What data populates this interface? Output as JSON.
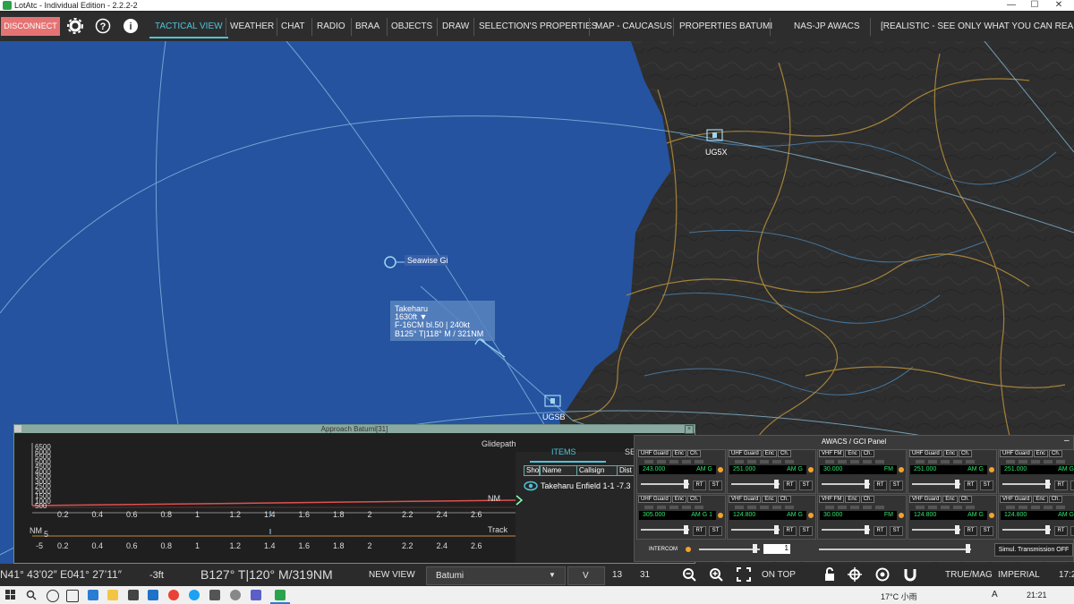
{
  "window": {
    "title": "LotAtc - Individual Edition - 2.2.2-2",
    "minimize": "—",
    "maximize": "☐",
    "close": "✕"
  },
  "menu": {
    "disconnect": "DISCONNECT",
    "items": [
      "TACTICAL VIEW",
      "WEATHER",
      "CHAT",
      "RADIO",
      "BRAA",
      "OBJECTS",
      "DRAW",
      "SELECTION'S PROPERTIES",
      "MAP - CAUCASUS",
      "PROPERTIES BATUMI",
      "NAS-JP AWACS",
      "[REALISTIC - SEE ONLY WHAT YOU CAN REALLY S"
    ]
  },
  "map": {
    "airbases": [
      {
        "name": "UG5X"
      },
      {
        "name": "UGSB"
      }
    ],
    "ship_label": "Seawise Gi",
    "track": {
      "line1": "Takeharu",
      "line2": "1630ft  ▼",
      "line3": "F-16CM bl.50 | 240kt",
      "line4": "B125°  T|118°  M / 321NM"
    }
  },
  "approach": {
    "title": "Approach Batumi[31]",
    "glidepath_label": "Glidepath",
    "track_label": "Track",
    "nm_label": "NM",
    "nm_label2": "NM",
    "y_ticks": [
      "6500",
      "6000",
      "5500",
      "5000",
      "4500",
      "4000",
      "3500",
      "3000",
      "2500",
      "2000",
      "1500",
      "1000",
      "500"
    ],
    "x_ticks": [
      "0.2",
      "0.4",
      "0.6",
      "0.8",
      "1",
      "1.2",
      "1.4",
      "1.6",
      "1.8",
      "2",
      "2.2",
      "2.4",
      "2.6"
    ],
    "track_y_ticks": [
      "5",
      "-5"
    ]
  },
  "items_panel": {
    "tab_items": "ITEMS",
    "tab_set": "SE",
    "columns": [
      "Sho",
      "Name",
      "Callsign",
      "Dist"
    ],
    "rows": [
      {
        "text": "Takeharu Enfield 1-1  -7.3"
      }
    ]
  },
  "awacs": {
    "title": "AWACS / GCI Panel",
    "radios": [
      {
        "type": "UHF Guard",
        "freq": "243.000",
        "mod": "AM G"
      },
      {
        "type": "UHF Guard",
        "freq": "251.000",
        "mod": "AM G"
      },
      {
        "type": "VHF FM",
        "freq": "30.000",
        "mod": "FM"
      },
      {
        "type": "UHF Guard",
        "freq": "251.000",
        "mod": "AM G"
      },
      {
        "type": "UHF Guard",
        "freq": "251.000",
        "mod": "AM G"
      },
      {
        "type": "UHF Guard",
        "freq": "305.000",
        "mod": "AM G  1"
      },
      {
        "type": "VHF Guard",
        "freq": "124.800",
        "mod": "AM G"
      },
      {
        "type": "VHF FM",
        "freq": "30.000",
        "mod": "FM"
      },
      {
        "type": "VHF Guard",
        "freq": "124.800",
        "mod": "AM G"
      },
      {
        "type": "VHF Guard",
        "freq": "124.800",
        "mod": "AM G"
      }
    ],
    "enc": "Enc",
    "ch": "Ch.",
    "rt": "RT",
    "st": "ST",
    "intercom": "INTERCOM",
    "intercom_value": "1",
    "simul": "Simul. Transmission OFF"
  },
  "status": {
    "coords": "N41° 43’02″ E041° 27’11″",
    "alt": "-3ft",
    "bearing": "B127°  T|120°  M/319NM",
    "new_view": "NEW VIEW",
    "airport": "Batumi",
    "v": "V",
    "n13": "13",
    "n31": "31",
    "on_top": "ON TOP",
    "true_mag": "TRUE/MAG",
    "imperial": "IMPERIAL",
    "time_cut": "17:2"
  },
  "taskbar": {
    "weather": "17°C  小雨",
    "ime": "A",
    "time": "21:21"
  }
}
